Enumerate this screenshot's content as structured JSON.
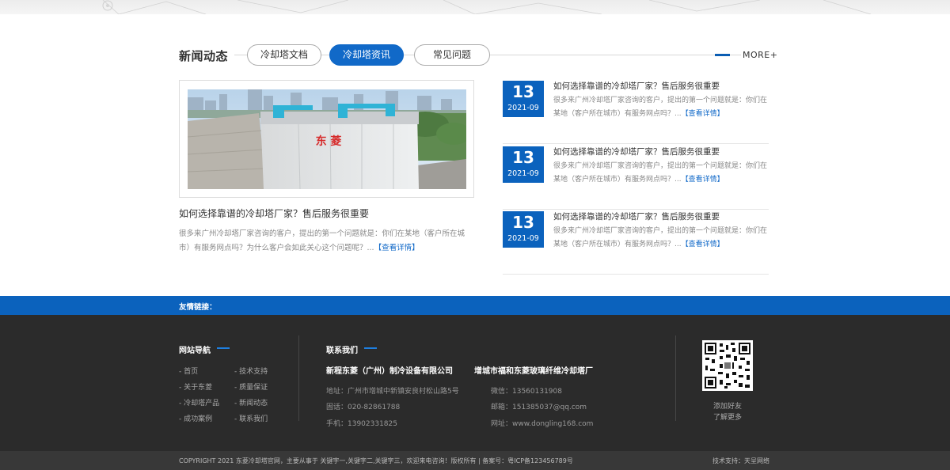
{
  "news": {
    "section_title": "新闻动态",
    "tabs": [
      {
        "label": "冷却塔文档",
        "active": false
      },
      {
        "label": "冷却塔资讯",
        "active": true
      },
      {
        "label": "常见问题",
        "active": false
      }
    ],
    "more_label": "MORE+",
    "featured": {
      "image_sign": "东 菱",
      "title": "如何选择靠谱的冷却塔厂家？售后服务很重要",
      "desc": "很多来广州冷却塔厂家咨询的客户，提出的第一个问题就是：你们在某地（客户所在城市）有服务网点吗？为什么客户会如此关心这个问题呢？...",
      "link": "【查看详情】"
    },
    "items": [
      {
        "day": "13",
        "ym": "2021-09",
        "title": "如何选择靠谱的冷却塔厂家？售后服务很重要",
        "desc": "很多来广州冷却塔厂家咨询的客户，提出的第一个问题就是：你们在某地（客户所在城市）有服务网点吗？...",
        "link": "【查看详情】"
      },
      {
        "day": "13",
        "ym": "2021-09",
        "title": "如何选择靠谱的冷却塔厂家？售后服务很重要",
        "desc": "很多来广州冷却塔厂家咨询的客户，提出的第一个问题就是：你们在某地（客户所在城市）有服务网点吗？...",
        "link": "【查看详情】"
      },
      {
        "day": "13",
        "ym": "2021-09",
        "title": "如何选择靠谱的冷却塔厂家？售后服务很重要",
        "desc": "很多来广州冷却塔厂家咨询的客户，提出的第一个问题就是：你们在某地（客户所在城市）有服务网点吗？...",
        "link": "【查看详情】"
      }
    ]
  },
  "friend_links": {
    "label": "友情链接："
  },
  "footer": {
    "nav": {
      "title": "网站导航",
      "links": [
        "- 首页",
        "- 技术支持",
        "- 关于东菱",
        "- 质量保证",
        "- 冷却塔产品",
        "- 新闻动态",
        "- 成功案例",
        "- 联系我们"
      ]
    },
    "contact": {
      "title": "联系我们",
      "company1": "新程东菱（广州）制冷设备有限公司",
      "company2": "增城市福和东菱玻璃纤维冷却塔厂",
      "address": "地址：广州市增城中新镇安良村松山路5号",
      "phone": "固话：020-82861788",
      "mobile": "手机：13902331825",
      "wechat": "微信：13560131908",
      "email": "邮箱：151385037@qq.com",
      "website": "网址：www.dongling168.com"
    },
    "qr": {
      "caption1": "添加好友",
      "caption2": "了解更多"
    },
    "copyright": "COPYRIGHT 2021 东菱冷却塔官网，主要从事于 关键字一,关键字二,关键字三，欢迎来电咨询！版权所有 | 备案号：粤ICP备123456789号",
    "support": "技术支持：天呈网络"
  },
  "colors": {
    "primary_blue": "#0b62bd",
    "footer_bg": "#2b2b2b",
    "bottom_bar": "#383838"
  }
}
